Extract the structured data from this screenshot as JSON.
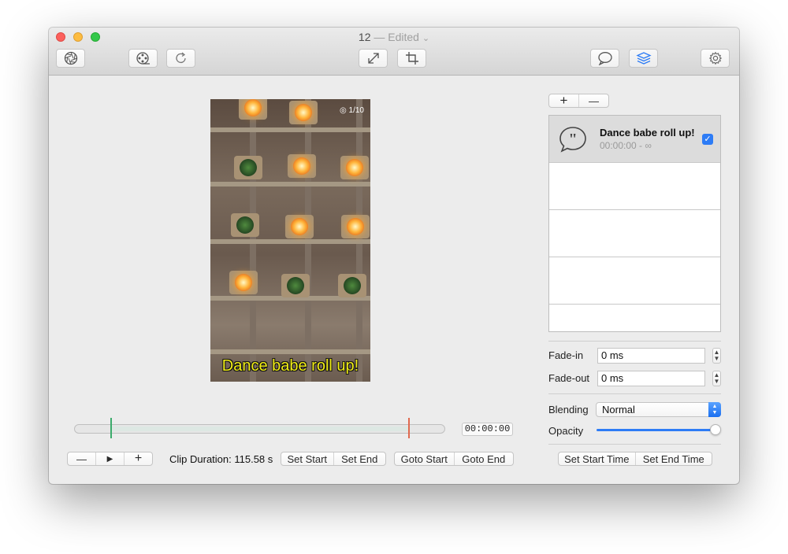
{
  "window": {
    "title_name": "12",
    "title_sep": " — ",
    "title_status": "Edited",
    "title_chevron": "⌄"
  },
  "toolbar": {
    "left": [
      "aperture-icon",
      "film-reel-icon",
      "rotate-icon"
    ],
    "center": [
      "resize-icon",
      "crop-icon"
    ],
    "right": [
      "speech-bubble-icon",
      "layers-icon",
      "gear-icon"
    ]
  },
  "video": {
    "caption": "Dance babe roll up!",
    "watermark": "◎ 1/10"
  },
  "timeline": {
    "timecode": "00:00:00"
  },
  "transport": {
    "minus": "—",
    "play": "▶",
    "plus": "+"
  },
  "clip": {
    "duration": "Clip Duration: 115.58 s"
  },
  "buttons": {
    "set_start": "Set Start",
    "set_end": "Set End",
    "goto_start": "Goto Start",
    "goto_end": "Goto End",
    "add": "+",
    "remove": "—",
    "set_start_time": "Set Start Time",
    "set_end_time": "Set End Time"
  },
  "layers": [
    {
      "title": "Dance babe roll up!",
      "time": "00:00:00 - ∞",
      "checked": true,
      "icon": "quote-bubble-icon"
    }
  ],
  "properties": {
    "fade_in_label": "Fade-in",
    "fade_in_value": "0 ms",
    "fade_out_label": "Fade-out",
    "fade_out_value": "0 ms",
    "blending_label": "Blending",
    "blending_value": "Normal",
    "opacity_label": "Opacity",
    "opacity_value": 1.0
  },
  "colors": {
    "accent": "#2d7cf6",
    "start_marker": "#3bab6b",
    "end_marker": "#e06a4f"
  }
}
